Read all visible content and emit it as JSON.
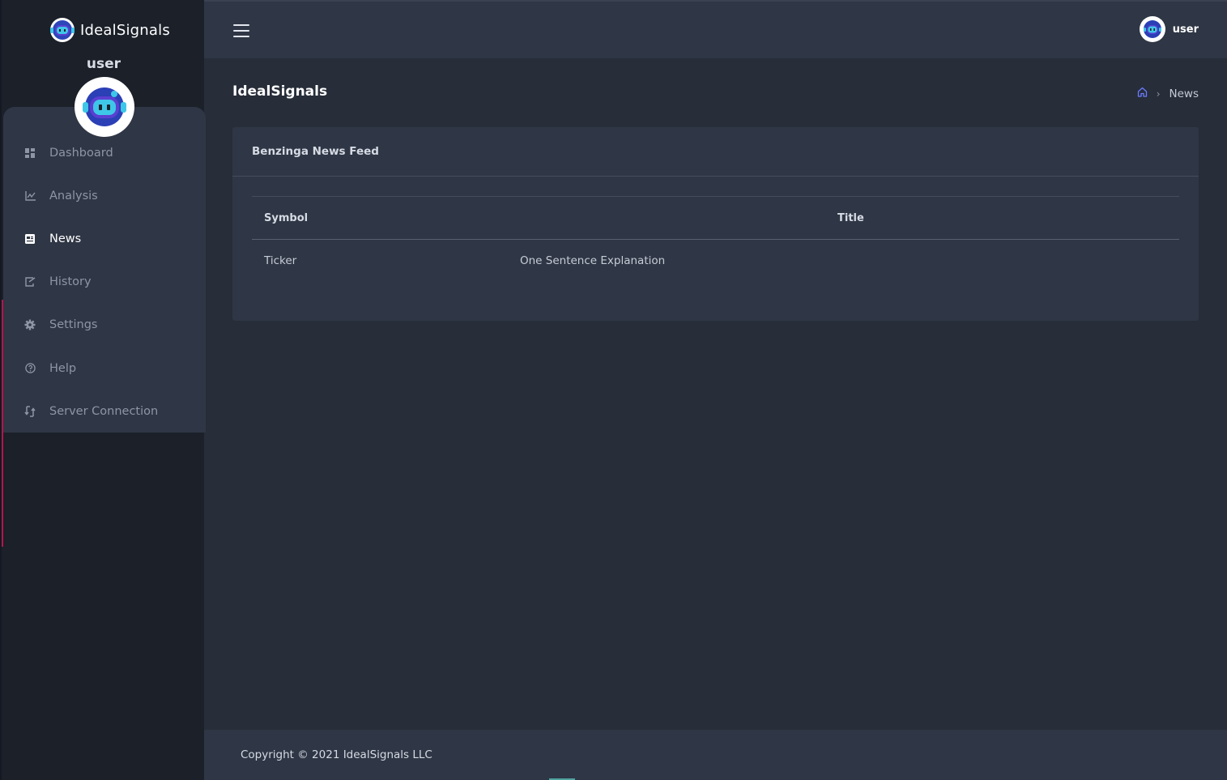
{
  "brand": {
    "name": "IdealSignals"
  },
  "sidebar": {
    "username": "user",
    "items": [
      {
        "label": "Dashboard",
        "icon": "dashboard-icon",
        "active": false
      },
      {
        "label": "Analysis",
        "icon": "chart-line-icon",
        "active": false
      },
      {
        "label": "News",
        "icon": "newspaper-icon",
        "active": true
      },
      {
        "label": "History",
        "icon": "history-icon",
        "active": false
      },
      {
        "label": "Settings",
        "icon": "gear-icon",
        "active": false
      },
      {
        "label": "Help",
        "icon": "help-circle-icon",
        "active": false
      },
      {
        "label": "Server Connection",
        "icon": "connection-icon",
        "active": false
      }
    ]
  },
  "topbar": {
    "username": "user",
    "menu_icon": "hamburger-icon"
  },
  "page": {
    "title": "IdealSignals",
    "breadcrumb": {
      "home_icon": "home-icon",
      "current": "News"
    }
  },
  "news_card": {
    "title": "Benzinga News Feed",
    "columns": [
      "Symbol",
      "Title"
    ],
    "rows": [
      {
        "symbol": "Ticker",
        "title": "One Sentence Explanation"
      }
    ]
  },
  "footer": {
    "copyright": "Copyright © 2021 IdealSignals LLC"
  },
  "colors": {
    "sidebar_bg": "#1b2029",
    "panel_bg": "#2f3645",
    "page_bg": "#272d39",
    "accent": "#b3164e",
    "link": "#6b7cff"
  }
}
